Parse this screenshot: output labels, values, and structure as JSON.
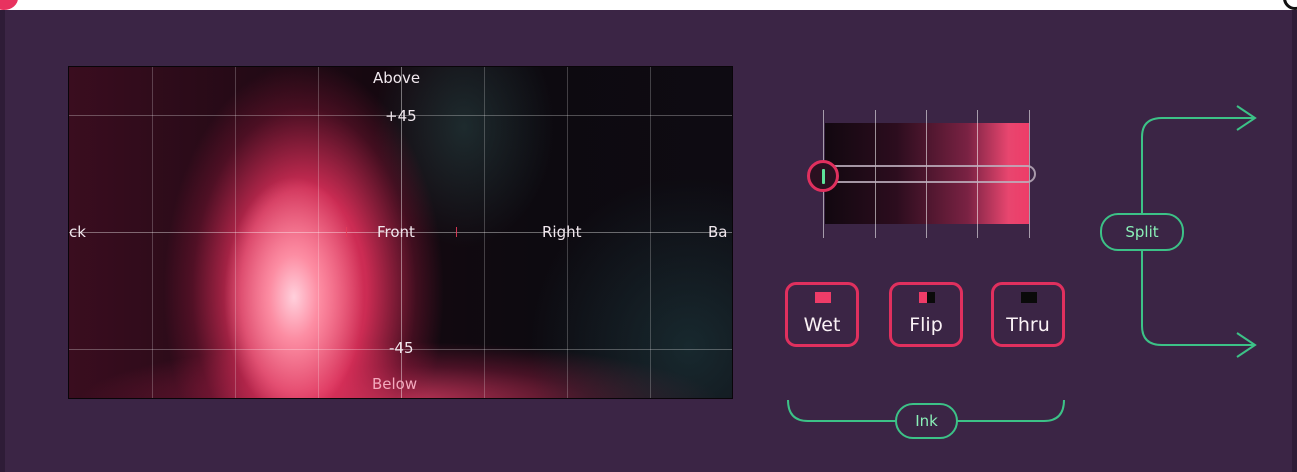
{
  "soundfield": {
    "labels": {
      "above": "Above",
      "plus45": "+45",
      "back_left": "ck",
      "front": "Front",
      "right": "Right",
      "back_right": "Ba",
      "minus45": "-45",
      "below": "Below"
    }
  },
  "meter": {
    "level": 0.0
  },
  "modes": [
    {
      "label": "Wet",
      "swatch": "solid-pink"
    },
    {
      "label": "Flip",
      "swatch": "pink-black-split"
    },
    {
      "label": "Thru",
      "swatch": "solid-black"
    }
  ],
  "routing": {
    "ink_label": "Ink",
    "split_label": "Split"
  },
  "colors": {
    "background": "#3b2545",
    "accent_pink": "#e0305e",
    "accent_green": "#3cc287"
  }
}
